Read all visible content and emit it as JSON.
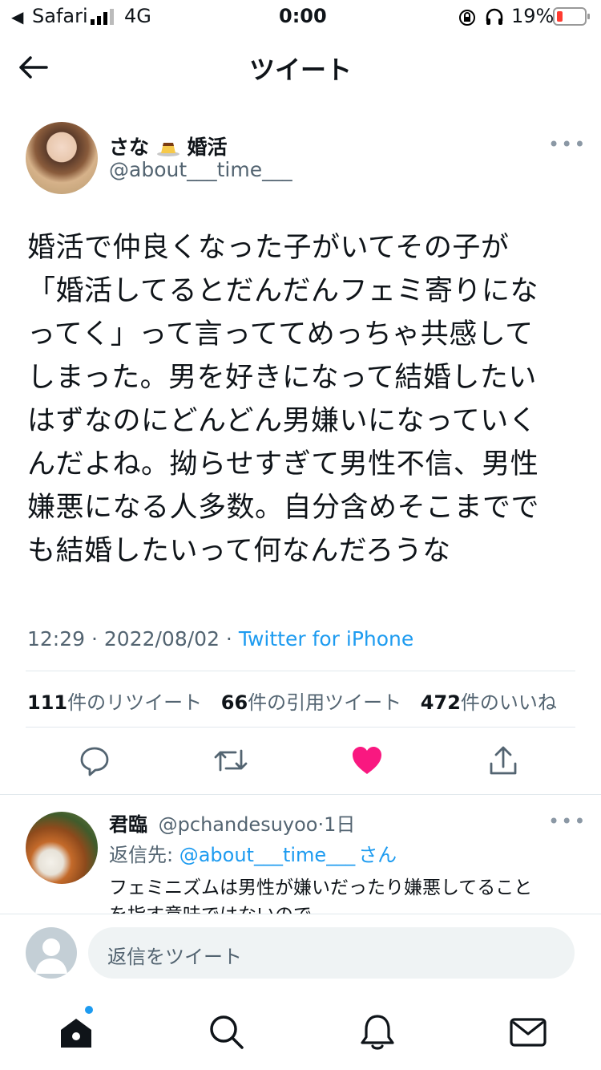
{
  "status_bar": {
    "carrier": "Safari",
    "network": "4G",
    "time": "0:00",
    "battery": "19%"
  },
  "header": {
    "title": "ツイート",
    "back_icon": "back-arrow-icon"
  },
  "tweet": {
    "display_name": "さな",
    "display_name_suffix": "婚活",
    "handle": "@about___time___",
    "lines": [
      "婚活で仲良くなった子がいてその子が",
      "「婚活してるとだんだんフェミ寄りにな",
      "ってく」って言っててめっちゃ共感して",
      "しまった。男を好きになって結婚したい",
      "はずなのにどんどん男嫌いになっていく",
      "んだよね。拗らせすぎて男性不信、男性",
      "嫌悪になる人多数。自分含めそこまでで",
      "も結婚したいって何なんだろうな"
    ],
    "time": "12:29 · 2022/08/02 · ",
    "source": "Twitter for iPhone",
    "retweets_count": "111",
    "retweets_label": "件のリツイート",
    "quotes_count": "66",
    "quotes_label": "件の引用ツイート",
    "likes_count": "472",
    "likes_label": "件のいいね",
    "like_color": "#f91880"
  },
  "reply": {
    "name": "君臨",
    "handle": "@pchandesuyoo",
    "age": "·1日",
    "reply_to_prefix": "返信先: ",
    "reply_to_handle": "@about___time___",
    "reply_to_suffix": "さん",
    "text_line1": "フェミニズムは男性が嫌いだったり嫌悪してること",
    "text_line2": "を指す意味ではないので"
  },
  "composer": {
    "placeholder": "返信をツイート"
  },
  "tab_bar": {
    "items": [
      "home-icon",
      "search-icon",
      "notifications-icon",
      "messages-icon"
    ]
  }
}
